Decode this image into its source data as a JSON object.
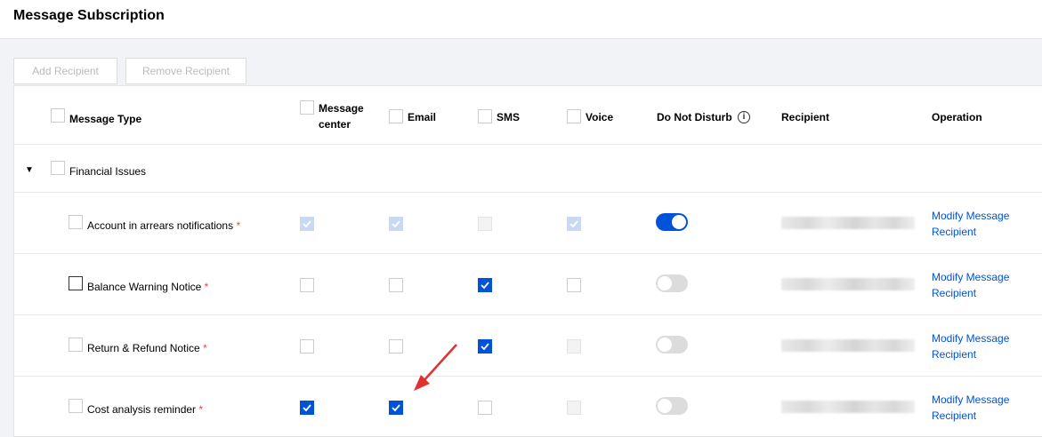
{
  "header": {
    "title": "Message Subscription"
  },
  "toolbar": {
    "add_label": "Add Recipient",
    "remove_label": "Remove Recipient"
  },
  "columns": {
    "message_type": "Message Type",
    "message_center_1": "Message",
    "message_center_2": "center",
    "email": "Email",
    "sms": "SMS",
    "voice": "Voice",
    "do_not_disturb": "Do Not Disturb",
    "recipient": "Recipient",
    "operation": "Operation"
  },
  "group": {
    "label": "Financial Issues",
    "expanded_icon": "caret-down-icon"
  },
  "rows": [
    {
      "label": "Account in arrears notifications",
      "required": "*",
      "message_center": "checked-disabled",
      "email": "checked-disabled",
      "sms": "disabled",
      "voice": "checked-disabled",
      "do_not_disturb": "on",
      "operation_1": "Modify Message",
      "operation_2": "Recipient"
    },
    {
      "label": "Balance Warning Notice",
      "required": "*",
      "message_center": "unchecked",
      "email": "unchecked",
      "sms": "checked",
      "voice": "unchecked",
      "do_not_disturb": "off",
      "operation_1": "Modify Message",
      "operation_2": "Recipient"
    },
    {
      "label": "Return & Refund Notice",
      "required": "*",
      "message_center": "unchecked",
      "email": "unchecked",
      "sms": "checked",
      "voice": "disabled",
      "do_not_disturb": "off",
      "operation_1": "Modify Message",
      "operation_2": "Recipient"
    },
    {
      "label": "Cost analysis reminder",
      "required": "*",
      "message_center": "checked",
      "email": "checked",
      "sms": "unchecked",
      "voice": "disabled",
      "do_not_disturb": "off",
      "operation_1": "Modify Message",
      "operation_2": "Recipient"
    }
  ],
  "colors": {
    "accent": "#0052d9",
    "required": "#e54545",
    "arrow": "#e03030"
  }
}
